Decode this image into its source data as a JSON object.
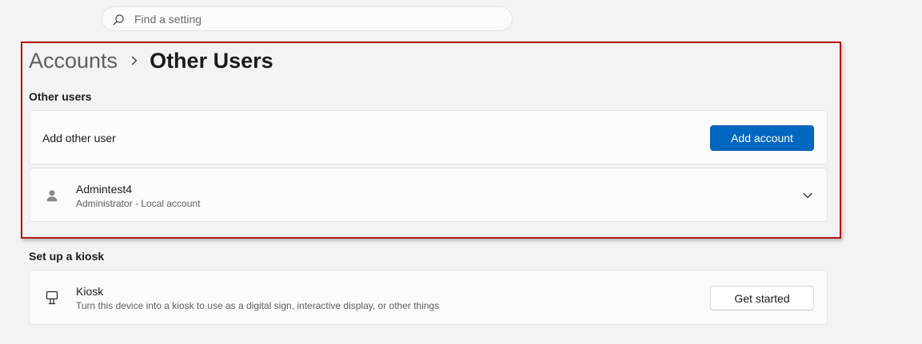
{
  "search": {
    "placeholder": "Find a setting",
    "icon": "search-icon"
  },
  "breadcrumb": {
    "parent": "Accounts",
    "separator_icon": "chevron-right-icon",
    "current": "Other Users"
  },
  "other_users": {
    "title": "Other users",
    "add_row": {
      "label": "Add other user",
      "button_label": "Add account"
    },
    "users": [
      {
        "name": "Admintest4",
        "subtitle": "Administrator - Local account",
        "icon": "user-avatar-icon",
        "expand_icon": "chevron-down-icon"
      }
    ]
  },
  "kiosk": {
    "title": "Set up a kiosk",
    "row": {
      "name": "Kiosk",
      "description": "Turn this device into a kiosk to use as a digital sign, interactive display, or other things",
      "icon": "kiosk-icon",
      "button_label": "Get started"
    }
  },
  "colors": {
    "accent": "#0067c0",
    "highlight_frame": "#b3151c",
    "background": "#f3f3f3",
    "card": "#fbfbfb"
  }
}
